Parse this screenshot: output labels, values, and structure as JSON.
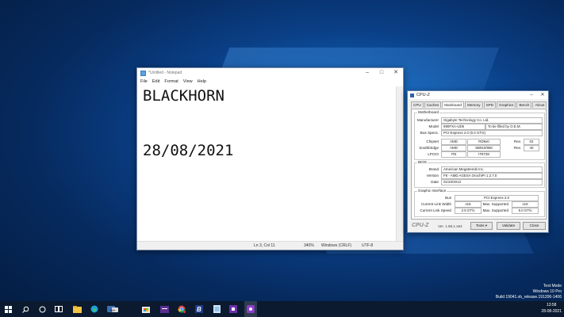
{
  "notepad": {
    "title": "*Untitled - Notepad",
    "menu": [
      "File",
      "Edit",
      "Format",
      "View",
      "Help"
    ],
    "lines": [
      "BLACKHORN",
      "",
      "",
      "28/08/2021"
    ],
    "status": {
      "position": "Ln 3, Col 11",
      "zoom": "340%",
      "line_ending": "Windows (CRLF)",
      "encoding": "UTF-8"
    }
  },
  "cpuz": {
    "title": "CPU-Z",
    "tabs": [
      "CPU",
      "Caches",
      "Mainboard",
      "Memory",
      "SPD",
      "Graphics",
      "Bench",
      "About"
    ],
    "active_tab": "Mainboard",
    "motherboard": {
      "group": "Motherboard",
      "manufacturer_label": "Manufacturer",
      "manufacturer": "Gigabyte Technology Co. Ltd.",
      "model_label": "Model",
      "model": "990FXA-UD5",
      "model_extra": "To be filled by O.E.M.",
      "bus_label": "Bus Specs.",
      "bus": "PCI-Express 2.0 (5.0 GT/s)",
      "chipset_label": "Chipset",
      "chipset_vendor": "AMD",
      "chipset": "RD9x0",
      "chipset_rev_label": "Rev.",
      "chipset_rev": "02",
      "southbridge_label": "Southbridge",
      "southbridge_vendor": "AMD",
      "southbridge": "SB910/950",
      "southbridge_rev_label": "Rev.",
      "southbridge_rev": "40",
      "lpcio_label": "LPCIO",
      "lpcio_vendor": "ITE",
      "lpcio": "IT8728"
    },
    "bios": {
      "group": "BIOS",
      "brand_label": "Brand",
      "brand": "American Megatrends Inc.",
      "version_label": "Version",
      "version": "F8 - AMD AGESA OrochiPI 1.2.7.0",
      "date_label": "Date",
      "date": "01/23/2013"
    },
    "graphic": {
      "group": "Graphic Interface",
      "bus_label": "Bus",
      "bus": "PCI-Express 2.0",
      "width_label": "Current Link Width",
      "width": "x16",
      "max_width_label": "Max. Supported",
      "max_width": "x16",
      "speed_label": "Current Link Speed",
      "speed": "2.5 GT/s",
      "max_speed_label": "Max. Supported",
      "max_speed": "5.0 GT/s"
    },
    "footer": {
      "logo": "CPU-Z",
      "version": "Ver. 1.96.1.x64",
      "tools": "Tools",
      "validate": "Validate",
      "close": "Close"
    }
  },
  "watermark": {
    "line1": "Test Mode",
    "line2": "Windows 10 Pro",
    "line3": "Build 19041.vb_release.191206-1406"
  },
  "taskbar": {
    "time": "13:58",
    "date": "28-08-2021",
    "icons": [
      "windows-start-icon",
      "search-icon",
      "cortana-icon",
      "task-view-icon",
      "file-explorer-icon",
      "edge-icon",
      "app-badge-icon",
      "store-icon",
      "app-purple-icon",
      "chrome-icon",
      "blackhorn-app-icon",
      "notepad-icon",
      "cpu-z-icon"
    ],
    "badge": "99+"
  }
}
